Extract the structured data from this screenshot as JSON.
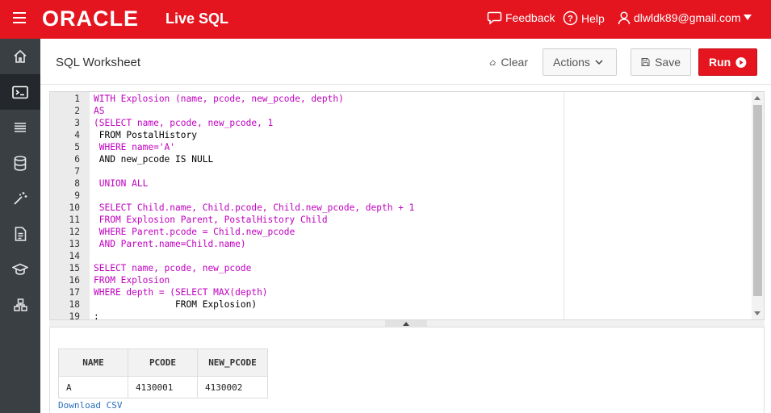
{
  "header": {
    "brand": "ORACLE",
    "product": "Live SQL",
    "feedback": "Feedback",
    "help": "Help",
    "user_email": "dlwldk89@gmail.com"
  },
  "sidebar": {
    "items": [
      {
        "icon": "home-icon"
      },
      {
        "icon": "sql-worksheet-icon",
        "active": true
      },
      {
        "icon": "list-icon"
      },
      {
        "icon": "database-icon"
      },
      {
        "icon": "wand-icon"
      },
      {
        "icon": "document-icon"
      },
      {
        "icon": "graduation-cap-icon"
      },
      {
        "icon": "schema-icon"
      }
    ]
  },
  "worksheet": {
    "title": "SQL Worksheet",
    "clear_label": "Clear",
    "actions_label": "Actions",
    "save_label": "Save",
    "run_label": "Run"
  },
  "editor": {
    "lines": [
      {
        "n": "1",
        "code": "WITH Explosion (name, pcode, new_pcode, depth)"
      },
      {
        "n": "2",
        "code": "AS"
      },
      {
        "n": "3",
        "code": "(SELECT name, pcode, new_pcode, 1"
      },
      {
        "n": "4",
        "code": " FROM PostalHistory"
      },
      {
        "n": "5",
        "code": " WHERE name='A'"
      },
      {
        "n": "6",
        "code": " AND new_pcode IS NULL"
      },
      {
        "n": "7",
        "code": ""
      },
      {
        "n": "8",
        "code": " UNION ALL"
      },
      {
        "n": "9",
        "code": ""
      },
      {
        "n": "10",
        "code": " SELECT Child.name, Child.pcode, Child.new_pcode, depth + 1"
      },
      {
        "n": "11",
        "code": " FROM Explosion Parent, PostalHistory Child"
      },
      {
        "n": "12",
        "code": " WHERE Parent.pcode = Child.new_pcode"
      },
      {
        "n": "13",
        "code": " AND Parent.name=Child.name)"
      },
      {
        "n": "14",
        "code": ""
      },
      {
        "n": "15",
        "code": "SELECT name, pcode, new_pcode"
      },
      {
        "n": "16",
        "code": "FROM Explosion"
      },
      {
        "n": "17",
        "code": "WHERE depth = (SELECT MAX(depth)"
      },
      {
        "n": "18",
        "code": "               FROM Explosion)"
      },
      {
        "n": "19",
        "code": ";"
      }
    ]
  },
  "results": {
    "columns": [
      "NAME",
      "PCODE",
      "NEW_PCODE"
    ],
    "rows": [
      [
        "A",
        "4130001",
        "4130002"
      ]
    ],
    "download_label": "Download CSV"
  }
}
